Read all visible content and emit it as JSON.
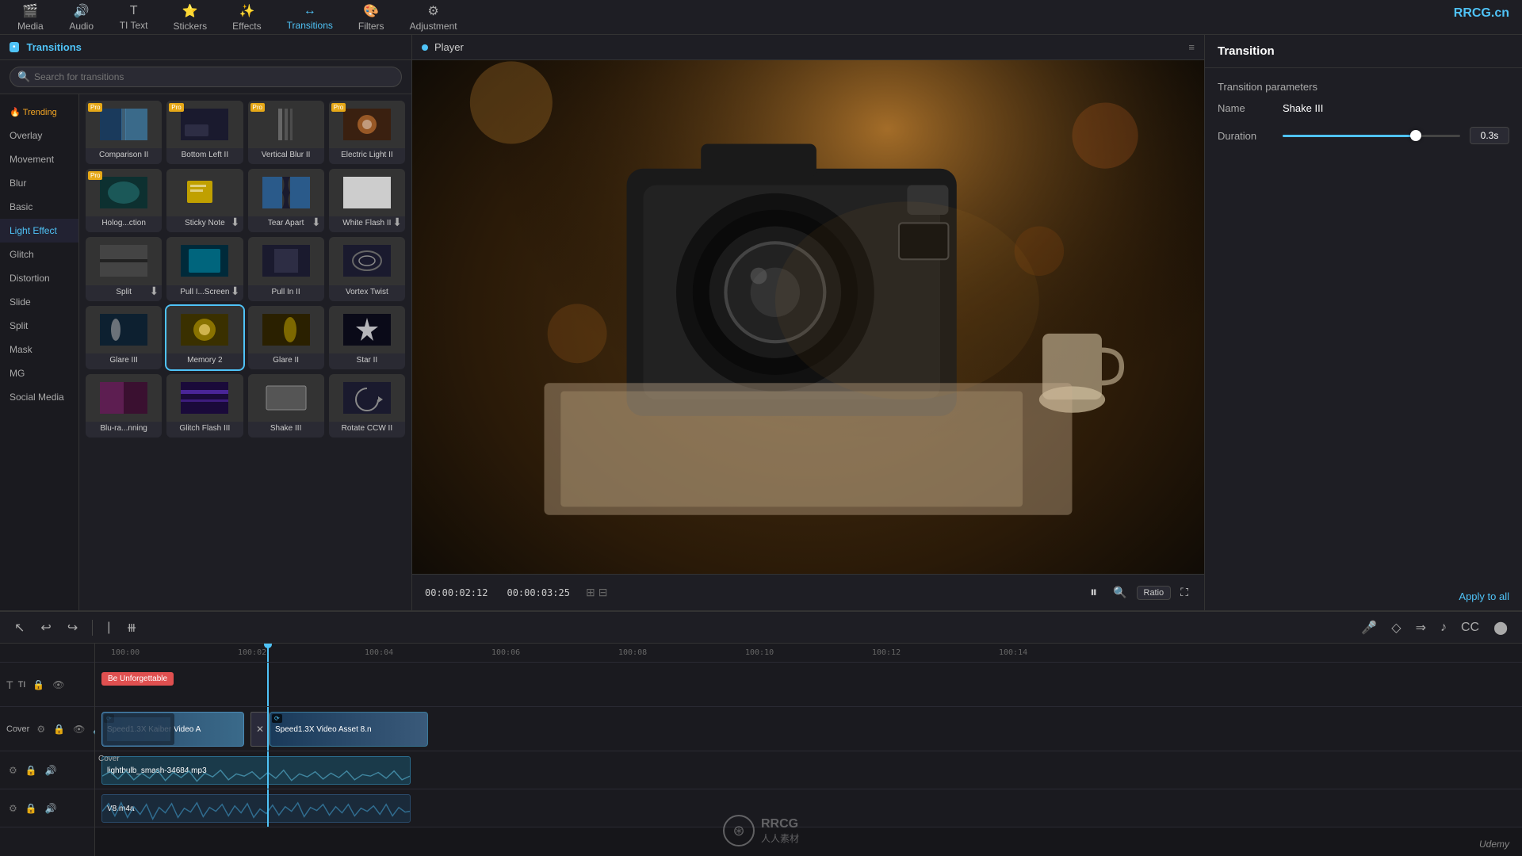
{
  "brand": {
    "logo": "RRCG.cn",
    "udemy": "Udemy"
  },
  "topnav": {
    "items": [
      {
        "id": "media",
        "label": "Media",
        "icon": "🎬"
      },
      {
        "id": "audio",
        "label": "Audio",
        "icon": "🔊"
      },
      {
        "id": "text",
        "label": "TI Text",
        "icon": "T"
      },
      {
        "id": "stickers",
        "label": "Stickers",
        "icon": "⭐"
      },
      {
        "id": "effects",
        "label": "Effects",
        "icon": "✨"
      },
      {
        "id": "transitions",
        "label": "Transitions",
        "icon": "↔"
      },
      {
        "id": "filters",
        "label": "Filters",
        "icon": "🎨"
      },
      {
        "id": "adjustment",
        "label": "Adjustment",
        "icon": "⚙"
      }
    ],
    "active": "transitions"
  },
  "leftPanel": {
    "activeTab": "Transitions",
    "search": {
      "placeholder": "Search for transitions"
    },
    "sidebar": {
      "items": [
        {
          "id": "trending",
          "label": "Trending",
          "special": true
        },
        {
          "id": "overlay",
          "label": "Overlay"
        },
        {
          "id": "movement",
          "label": "Movement"
        },
        {
          "id": "blur",
          "label": "Blur"
        },
        {
          "id": "basic",
          "label": "Basic"
        },
        {
          "id": "light-effect",
          "label": "Light Effect"
        },
        {
          "id": "glitch",
          "label": "Glitch"
        },
        {
          "id": "distortion",
          "label": "Distortion"
        },
        {
          "id": "slide",
          "label": "Slide"
        },
        {
          "id": "split",
          "label": "Split"
        },
        {
          "id": "mask",
          "label": "Mask"
        },
        {
          "id": "mg",
          "label": "MG"
        },
        {
          "id": "social-media",
          "label": "Social Media"
        }
      ]
    },
    "grid": {
      "items": [
        {
          "label": "Comparison II",
          "badge": "Pro",
          "thumb": "blue"
        },
        {
          "label": "Bottom Left II",
          "badge": "Pro",
          "thumb": "dark"
        },
        {
          "label": "Vertical Blur II",
          "badge": "Pro",
          "thumb": "grey"
        },
        {
          "label": "Electric Light II",
          "badge": "Pro",
          "thumb": "orange"
        },
        {
          "label": "Holog...ction",
          "badge": "Pro",
          "thumb": "teal"
        },
        {
          "label": "Sticky Note",
          "badge": "",
          "thumb": "yellow",
          "download": true
        },
        {
          "label": "Tear Apart",
          "badge": "",
          "thumb": "blue",
          "download": true
        },
        {
          "label": "White Flash II",
          "badge": "",
          "thumb": "white",
          "download": true
        },
        {
          "label": "Split",
          "badge": "",
          "thumb": "grey",
          "download": true
        },
        {
          "label": "Pull I...Screen",
          "badge": "",
          "thumb": "cyan",
          "download": true
        },
        {
          "label": "Pull In II",
          "badge": "",
          "thumb": "dark"
        },
        {
          "label": "Vortex Twist",
          "badge": "",
          "thumb": "dark"
        },
        {
          "label": "Glare III",
          "badge": "",
          "thumb": "teal"
        },
        {
          "label": "Memory 2",
          "badge": "",
          "thumb": "yellow",
          "highlighted": true
        },
        {
          "label": "Glare II",
          "badge": "",
          "thumb": "yellow"
        },
        {
          "label": "Star II",
          "badge": "",
          "thumb": "dark"
        },
        {
          "label": "Blu-ra...nning",
          "badge": "",
          "thumb": "pink"
        },
        {
          "label": "Glitch Flash III",
          "badge": "",
          "thumb": "purple"
        },
        {
          "label": "Shake III",
          "badge": "",
          "thumb": "grey"
        },
        {
          "label": "Rotate CCW II",
          "badge": "",
          "thumb": "dark"
        }
      ]
    }
  },
  "player": {
    "label": "Player",
    "currentTime": "00:00:02:12",
    "totalTime": "00:00:03:25",
    "ratioLabel": "Ratio"
  },
  "rightPanel": {
    "title": "Transition",
    "params": {
      "title": "Transition parameters",
      "nameLabel": "Name",
      "nameValue": "Shake III",
      "durationLabel": "Duration",
      "durationValue": "0.3s"
    },
    "applyToAll": "Apply to all"
  },
  "timeline": {
    "toolbar": {
      "undoLabel": "↩",
      "redoLabel": "↪",
      "cutLabel": "✂",
      "splitLabel": "⧻"
    },
    "ruler": {
      "ticks": [
        "100:00",
        "100:02",
        "100:04",
        "100:06",
        "100:08",
        "100:10",
        "100:12",
        "100:14"
      ]
    },
    "tracks": [
      {
        "type": "text",
        "label": "TI",
        "clips": [
          {
            "label": "Be Unforgettable",
            "type": "chip"
          }
        ]
      },
      {
        "type": "video",
        "label": "Cover",
        "clips": [
          {
            "label": "Speed1.3X  Kaiber Video A",
            "type": "video"
          },
          {
            "label": "Speed1.3X  Video Asset 8.n",
            "type": "video2"
          }
        ]
      },
      {
        "type": "audio",
        "label": "",
        "file": "lightbulb_smash-34684.mp3"
      },
      {
        "type": "audio2",
        "label": "",
        "file": "V8.m4a"
      }
    ]
  }
}
